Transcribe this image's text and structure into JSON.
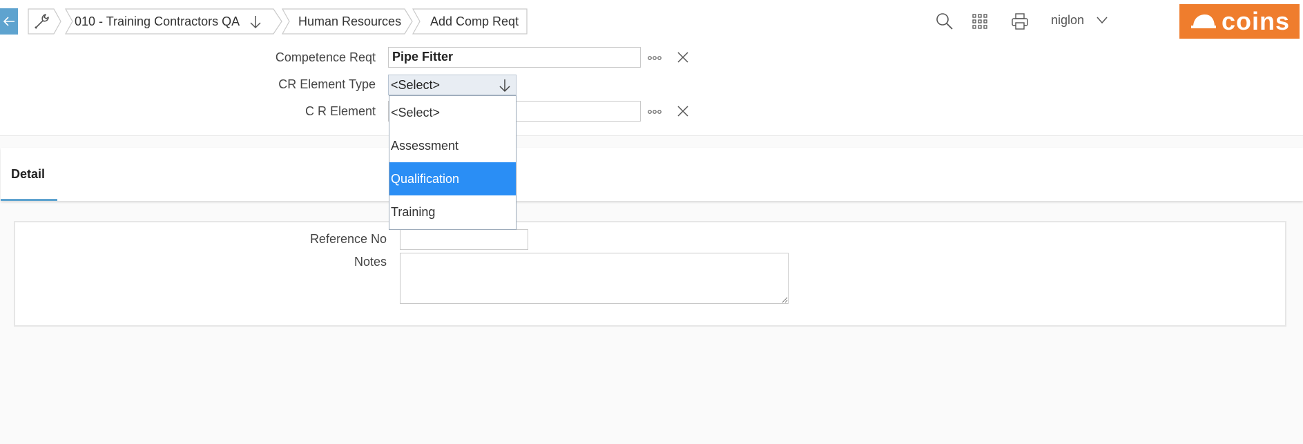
{
  "breadcrumbs": [
    {
      "label": "010 - Training Contractors QA"
    },
    {
      "label": "Human Resources"
    },
    {
      "label": "Add Comp Reqt"
    }
  ],
  "header": {
    "user": "niglon",
    "logo_text": "coins",
    "icons": [
      "back-arrow-icon",
      "wrench-icon",
      "search-icon",
      "apps-grid-icon",
      "printer-icon",
      "chevron-down-icon"
    ]
  },
  "form": {
    "competence_reqt": {
      "label": "Competence Reqt",
      "value": "Pipe Fitter"
    },
    "cr_element_type": {
      "label": "CR Element Type",
      "value": "<Select>"
    },
    "cr_element": {
      "label": "C R Element",
      "value": ""
    }
  },
  "dropdown": {
    "options": [
      "<Select>",
      "Assessment",
      "Qualification",
      "Training"
    ],
    "highlighted": "Qualification"
  },
  "tabs": [
    {
      "label": "Detail",
      "active": true
    }
  ],
  "detail": {
    "reference_no": {
      "label": "Reference No",
      "value": ""
    },
    "notes": {
      "label": "Notes",
      "value": ""
    }
  },
  "colors": {
    "accent": "#5ea3cf",
    "brand": "#ef7d2d",
    "selection": "#2a8ef5"
  }
}
